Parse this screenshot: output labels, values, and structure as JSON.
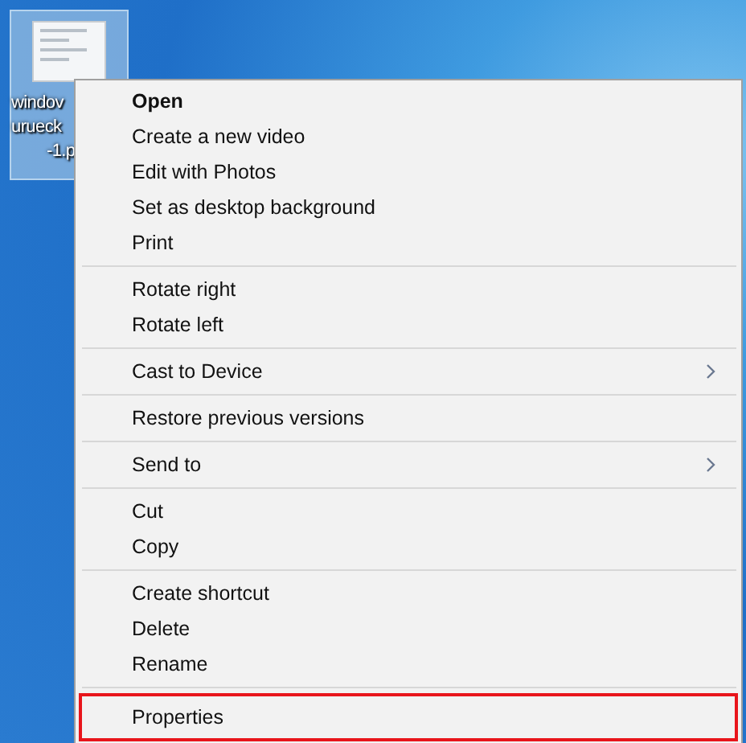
{
  "desktop_icon": {
    "label_lines": [
      "windov",
      "urueck",
      "-1.p"
    ],
    "selected": true
  },
  "context_menu": {
    "groups": [
      {
        "items": [
          {
            "label": "Open",
            "bold": true,
            "submenu": false,
            "highlighted": false
          },
          {
            "label": "Create a new video",
            "bold": false,
            "submenu": false,
            "highlighted": false
          },
          {
            "label": "Edit with Photos",
            "bold": false,
            "submenu": false,
            "highlighted": false
          },
          {
            "label": "Set as desktop background",
            "bold": false,
            "submenu": false,
            "highlighted": false
          },
          {
            "label": "Print",
            "bold": false,
            "submenu": false,
            "highlighted": false
          }
        ]
      },
      {
        "items": [
          {
            "label": "Rotate right",
            "bold": false,
            "submenu": false,
            "highlighted": false
          },
          {
            "label": "Rotate left",
            "bold": false,
            "submenu": false,
            "highlighted": false
          }
        ]
      },
      {
        "items": [
          {
            "label": "Cast to Device",
            "bold": false,
            "submenu": true,
            "highlighted": false
          }
        ]
      },
      {
        "items": [
          {
            "label": "Restore previous versions",
            "bold": false,
            "submenu": false,
            "highlighted": false
          }
        ]
      },
      {
        "items": [
          {
            "label": "Send to",
            "bold": false,
            "submenu": true,
            "highlighted": false
          }
        ]
      },
      {
        "items": [
          {
            "label": "Cut",
            "bold": false,
            "submenu": false,
            "highlighted": false
          },
          {
            "label": "Copy",
            "bold": false,
            "submenu": false,
            "highlighted": false
          }
        ]
      },
      {
        "items": [
          {
            "label": "Create shortcut",
            "bold": false,
            "submenu": false,
            "highlighted": false
          },
          {
            "label": "Delete",
            "bold": false,
            "submenu": false,
            "highlighted": false
          },
          {
            "label": "Rename",
            "bold": false,
            "submenu": false,
            "highlighted": false
          }
        ]
      },
      {
        "items": [
          {
            "label": "Properties",
            "bold": false,
            "submenu": false,
            "highlighted": true
          }
        ]
      }
    ]
  }
}
